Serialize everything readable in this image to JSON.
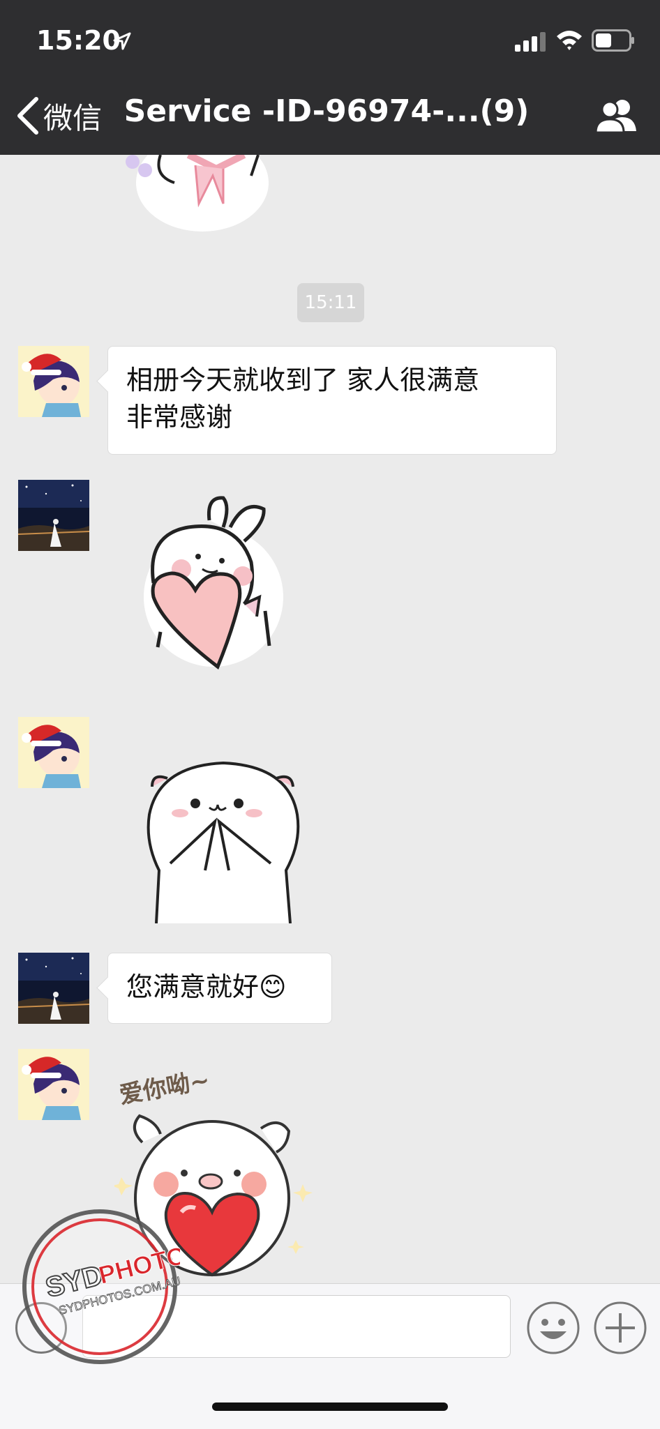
{
  "status_bar": {
    "time": "15:20",
    "icons": [
      "location-arrow-icon",
      "signal-icon",
      "wifi-icon",
      "battery-icon"
    ]
  },
  "nav": {
    "back_label": "微信",
    "title": "Service -ID-96974-...(9)",
    "members_icon": "group-members-icon"
  },
  "chat": {
    "timestamp": "15:11",
    "messages": [
      {
        "sender": "customer",
        "type": "text",
        "lines": [
          "相册今天就收到了 家人很满意",
          "非常感谢"
        ]
      },
      {
        "sender": "service",
        "type": "sticker",
        "sticker": "bunny-holding-heart"
      },
      {
        "sender": "customer",
        "type": "sticker",
        "sticker": "bear-thank-you"
      },
      {
        "sender": "service",
        "type": "text",
        "text": "您满意就好",
        "emoji": "😊"
      },
      {
        "sender": "customer",
        "type": "sticker",
        "sticker": "pig-love-heart",
        "caption": "爱你呦~"
      }
    ]
  },
  "input_bar": {
    "icons": [
      "voice-icon",
      "emoji-icon",
      "plus-icon"
    ]
  },
  "watermark": {
    "brand_left": "SYD",
    "brand_right": "PHOTOS",
    "url": "SYDPHOTOS.COM.AU"
  },
  "colors": {
    "nav_background": "#2e2e30",
    "chat_background": "#ebebeb",
    "bubble_background": "#ffffff",
    "watermark_red": "#d9262c"
  }
}
